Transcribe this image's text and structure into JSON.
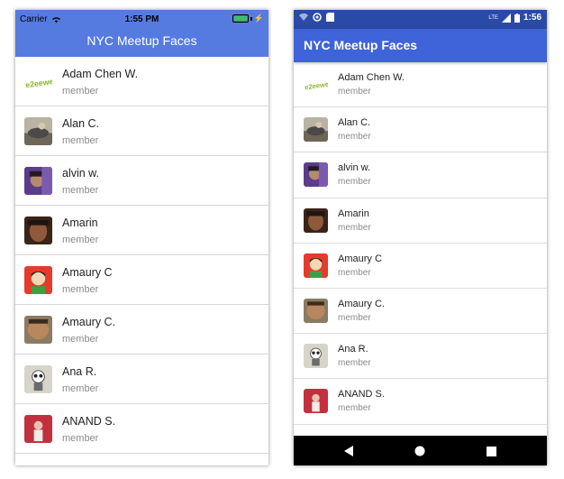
{
  "ios": {
    "carrier": "Carrier",
    "time": "1:55 PM",
    "nav_title": "NYC Meetup Faces",
    "members": [
      {
        "name": "Adam Chen W.",
        "role": "member"
      },
      {
        "name": "Alan C.",
        "role": "member"
      },
      {
        "name": "alvin w.",
        "role": "member"
      },
      {
        "name": "Amarin",
        "role": "member"
      },
      {
        "name": "Amaury C",
        "role": "member"
      },
      {
        "name": "Amaury C.",
        "role": "member"
      },
      {
        "name": "Ana R.",
        "role": "member"
      },
      {
        "name": "ANAND S.",
        "role": "member"
      }
    ]
  },
  "android": {
    "time": "1:56",
    "network_label": "LTE",
    "app_title": "NYC Meetup Faces",
    "members": [
      {
        "name": "Adam Chen W.",
        "role": "member"
      },
      {
        "name": "Alan C.",
        "role": "member"
      },
      {
        "name": "alvin w.",
        "role": "member"
      },
      {
        "name": "Amarin",
        "role": "member"
      },
      {
        "name": "Amaury C",
        "role": "member"
      },
      {
        "name": "Amaury C.",
        "role": "member"
      },
      {
        "name": "Ana R.",
        "role": "member"
      },
      {
        "name": "ANAND S.",
        "role": "member"
      }
    ]
  },
  "avatars": {
    "logo_text": "e2eewel",
    "icons": [
      "logo-avatar",
      "photo-avatar-car",
      "photo-avatar-purple",
      "photo-avatar-brown",
      "cartoon-avatar-red",
      "photo-avatar-face",
      "cartoon-avatar-panda",
      "photo-avatar-red"
    ]
  },
  "colors": {
    "ios_header": "#567be0",
    "android_status": "#2a4aa7",
    "android_appbar": "#3f63d8",
    "divider": "#d6d6d6",
    "secondary_text": "#8a8a8a"
  }
}
